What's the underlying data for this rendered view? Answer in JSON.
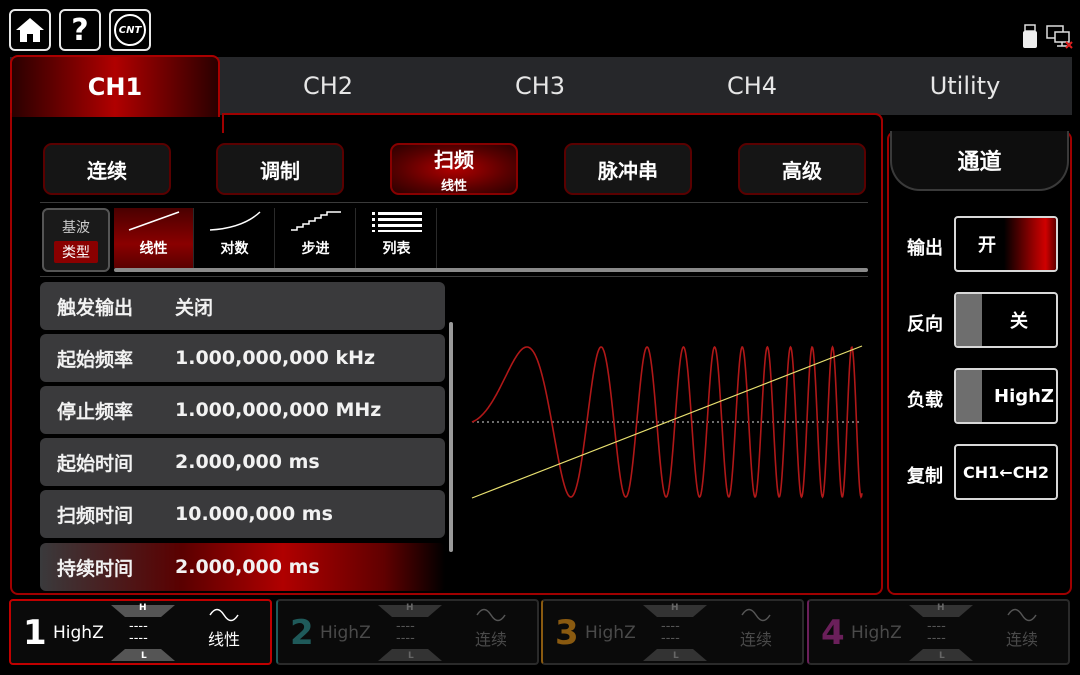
{
  "header": {
    "home_icon": "home-icon",
    "help_icon": "help-icon",
    "logo_text": "CNT",
    "status_icons": [
      "usb-icon",
      "network-disconnected-icon"
    ]
  },
  "tabs": [
    {
      "label": "CH1",
      "active": true
    },
    {
      "label": "CH2",
      "active": false
    },
    {
      "label": "CH3",
      "active": false
    },
    {
      "label": "CH4",
      "active": false
    },
    {
      "label": "Utility",
      "active": false
    }
  ],
  "modes": {
    "continuous": "连续",
    "modulation": "调制",
    "sweep": "扫频",
    "sweep_sub": "线性",
    "burst": "脉冲串",
    "advanced": "高级"
  },
  "base_type": {
    "top": "基波",
    "bottom": "类型"
  },
  "sweep_types": [
    "线性",
    "对数",
    "步进",
    "列表"
  ],
  "params": [
    {
      "label": "触发输出",
      "value": "关闭"
    },
    {
      "label": "起始频率",
      "value": "1.000,000,000 kHz"
    },
    {
      "label": "停止频率",
      "value": "1.000,000,000 MHz"
    },
    {
      "label": "起始时间",
      "value": "2.000,000 ms"
    },
    {
      "label": "扫频时间",
      "value": "10.000,000 ms"
    },
    {
      "label": "持续时间",
      "value": "2.000,000 ms"
    }
  ],
  "side": {
    "title": "通道",
    "output_label": "输出",
    "output_value": "开",
    "invert_label": "反向",
    "invert_value": "关",
    "load_label": "负载",
    "load_value": "HighZ",
    "copy_label": "复制",
    "copy_value": "CH1←CH2"
  },
  "channels": [
    {
      "num": "1",
      "load": "HighZ",
      "h": "H",
      "l": "L",
      "dash1": "----",
      "dash2": "----",
      "mode": "线性",
      "color": "#c00000",
      "enabled": true
    },
    {
      "num": "2",
      "load": "HighZ",
      "h": "H",
      "l": "L",
      "dash1": "----",
      "dash2": "----",
      "mode": "连续",
      "color": "#1f5a5a",
      "enabled": false
    },
    {
      "num": "3",
      "load": "HighZ",
      "h": "H",
      "l": "L",
      "dash1": "----",
      "dash2": "----",
      "mode": "连续",
      "color": "#8a5a10",
      "enabled": false
    },
    {
      "num": "4",
      "load": "HighZ",
      "h": "H",
      "l": "L",
      "dash1": "----",
      "dash2": "----",
      "mode": "连续",
      "color": "#6a1f5a",
      "enabled": false
    }
  ],
  "colors": {
    "accent": "#a00000",
    "waveform": "#b01818",
    "ramp": "#e8e070"
  }
}
